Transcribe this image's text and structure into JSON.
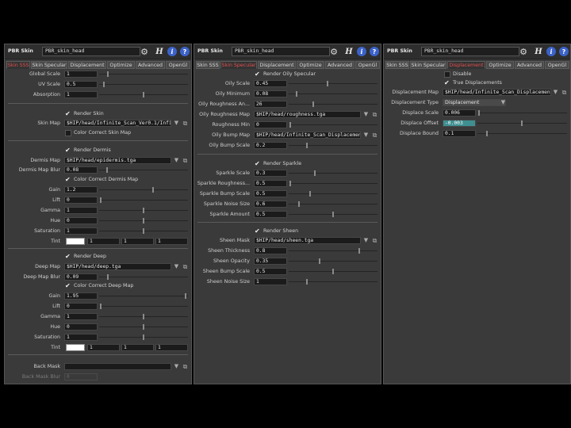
{
  "left": {
    "type": "PBR Skin",
    "name": "PBR_skin_head",
    "tabs": [
      "Skin SSS",
      "Skin Specular",
      "Displacement",
      "Optimize",
      "Advanced",
      "OpenGl"
    ],
    "global_scale": {
      "label": "Global Scale",
      "value": "1"
    },
    "uv_scale": {
      "label": "UV Scale",
      "value": "0.5"
    },
    "absorption": {
      "label": "Absorption",
      "value": "1"
    },
    "render_skin": "Render Skin",
    "skin_map": {
      "label": "Skin Map",
      "value": "$HIP/head/Infinite_Scan_Ver0.1/Infin"
    },
    "color_correct_skin": "Color Correct Skin Map",
    "render_dermis": "Render Dermis",
    "dermis_map": {
      "label": "Dermis Map",
      "value": "$HIP/head/epidermis.tga"
    },
    "dermis_blur": {
      "label": "Dermis Map Blur",
      "value": "0.08"
    },
    "color_correct_dermis": "Color Correct Dermis Map",
    "dermis_gain": {
      "label": "Gain",
      "value": "1.2"
    },
    "dermis_lift": {
      "label": "Lift",
      "value": "0"
    },
    "dermis_gamma": {
      "label": "Gamma",
      "value": "1"
    },
    "dermis_hue": {
      "label": "Hue",
      "value": "0"
    },
    "dermis_saturation": {
      "label": "Saturation",
      "value": "1"
    },
    "dermis_tint": {
      "label": "Tint",
      "r": "1",
      "g": "1",
      "b": "1"
    },
    "render_deep": "Render Deep",
    "deep_map": {
      "label": "Deep Map",
      "value": "$HIP/head/deep.tga"
    },
    "deep_blur": {
      "label": "Deep Map Blur",
      "value": "0.09"
    },
    "color_correct_deep": "Color Correct Deep Map",
    "deep_gain": {
      "label": "Gain",
      "value": "1.95"
    },
    "deep_lift": {
      "label": "Lift",
      "value": "0"
    },
    "deep_gamma": {
      "label": "Gamma",
      "value": "1"
    },
    "deep_hue": {
      "label": "Hue",
      "value": "0"
    },
    "deep_saturation": {
      "label": "Saturation",
      "value": "1"
    },
    "deep_tint": {
      "label": "Tint",
      "r": "1",
      "g": "1",
      "b": "1"
    },
    "back_mask": {
      "label": "Back Mask",
      "value": ""
    },
    "back_mask_blur": {
      "label": "Back Mask Blur",
      "value": "0"
    }
  },
  "middle": {
    "type": "PBR Skin",
    "name": "PBR_skin_head",
    "tabs": [
      "Skin SSS",
      "Skin Specular",
      "Displacement",
      "Optimize",
      "Advanced",
      "OpenGl"
    ],
    "render_oily": "Render Oily Specular",
    "oily_scale": {
      "label": "Oily Scale",
      "value": "0.45"
    },
    "oily_minimum": {
      "label": "Oily Minimum",
      "value": "0.08"
    },
    "oily_roughness_an": {
      "label": "Oily Roughness An...",
      "value": "26"
    },
    "oily_roughness_map": {
      "label": "Oily Roughness Map",
      "value": "$HIP/head/roughness.tga"
    },
    "roughness_min": {
      "label": "Roughness Min",
      "value": "0"
    },
    "oily_bump_map": {
      "label": "Oily Bump Map",
      "value": "$HIP/head/Infinite_Scan_Displacement"
    },
    "oily_bump_scale": {
      "label": "Oily Bump Scale",
      "value": "0.2"
    },
    "render_sparkle": "Render Sparkle",
    "sparkle_scale": {
      "label": "Sparkle Scale",
      "value": "0.3"
    },
    "sparkle_roughness": {
      "label": "Sparkle Roughness...",
      "value": "0.5"
    },
    "sparkle_bump_scale": {
      "label": "Sparkle Bump Scale",
      "value": "0.5"
    },
    "sparkle_noise_size": {
      "label": "Sparkle Noise Size",
      "value": "0.6"
    },
    "sparkle_amount": {
      "label": "Sparkle Amount",
      "value": "0.5"
    },
    "render_sheen": "Render Sheen",
    "sheen_mask": {
      "label": "Sheen Mask",
      "value": "$HIP/head/sheen.tga"
    },
    "sheen_thickness": {
      "label": "Sheen Thickness",
      "value": "0.8"
    },
    "sheen_opacity": {
      "label": "Sheen Opacity",
      "value": "0.35"
    },
    "sheen_bump_scale": {
      "label": "Sheen Bump Scale",
      "value": "0.5"
    },
    "sheen_noise_size": {
      "label": "Sheen Noise Size",
      "value": "1"
    }
  },
  "right": {
    "type": "PBR Skin",
    "name": "PBR_skin_head",
    "tabs": [
      "Skin SSS",
      "Skin Specular",
      "Displacement",
      "Optimize",
      "Advanced",
      "OpenGl"
    ],
    "disable": "Disable",
    "true_displacements": "True Displacements",
    "displacement_map": {
      "label": "Displacement Map",
      "value": "$HIP/head/Infinite_Scan_Displacement"
    },
    "displacement_type": {
      "label": "Displacement Type",
      "value": "Displacement"
    },
    "displace_scale": {
      "label": "Displace Scale",
      "value": "0.006"
    },
    "displace_offset": {
      "label": "Displace Offset",
      "value": "-0.003"
    },
    "displace_bound": {
      "label": "Displace Bound",
      "value": "0.1"
    }
  },
  "icons": {
    "gear": "gear-icon",
    "hb": "houdini-help-browser-icon",
    "info": "info-icon",
    "help": "help-icon",
    "menu": "dropdown-arrow-icon",
    "op": "node-chooser-icon"
  },
  "colors": {
    "panel": "#3a3a3a",
    "field": "#1b1b1b",
    "active_tab": "#e24f4f",
    "highlight_field": "#3f8f91",
    "info_icon": "#3b62c9"
  }
}
